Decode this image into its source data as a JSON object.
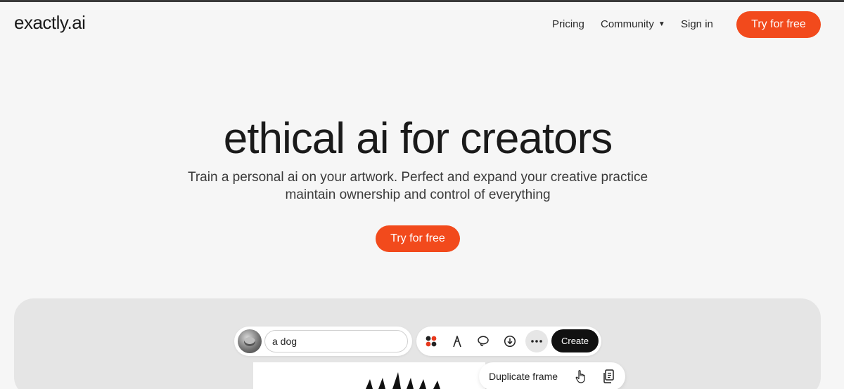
{
  "header": {
    "logo": "exactly.ai",
    "nav": {
      "pricing": "Pricing",
      "community": "Community",
      "sign_in": "Sign in",
      "try_free": "Try for free"
    }
  },
  "hero": {
    "title": "ethical ai for creators",
    "subtitle_line1": "Train a personal ai on your artwork. Perfect and expand your creative practice",
    "subtitle_line2": "maintain ownership and control of everything",
    "cta": "Try for free"
  },
  "demo": {
    "prompt_value": "a dog",
    "tools": [
      "palette-icon",
      "pen-icon",
      "lasso-icon",
      "download-icon",
      "more-icon"
    ],
    "create_label": "Create",
    "context_menu": {
      "label": "Duplicate frame",
      "icons": [
        "hand-pointer-icon",
        "copy-icon"
      ]
    }
  },
  "colors": {
    "accent": "#f24a1c",
    "background": "#f6f6f6",
    "panel": "#e5e5e5",
    "dark_button": "#111111"
  }
}
